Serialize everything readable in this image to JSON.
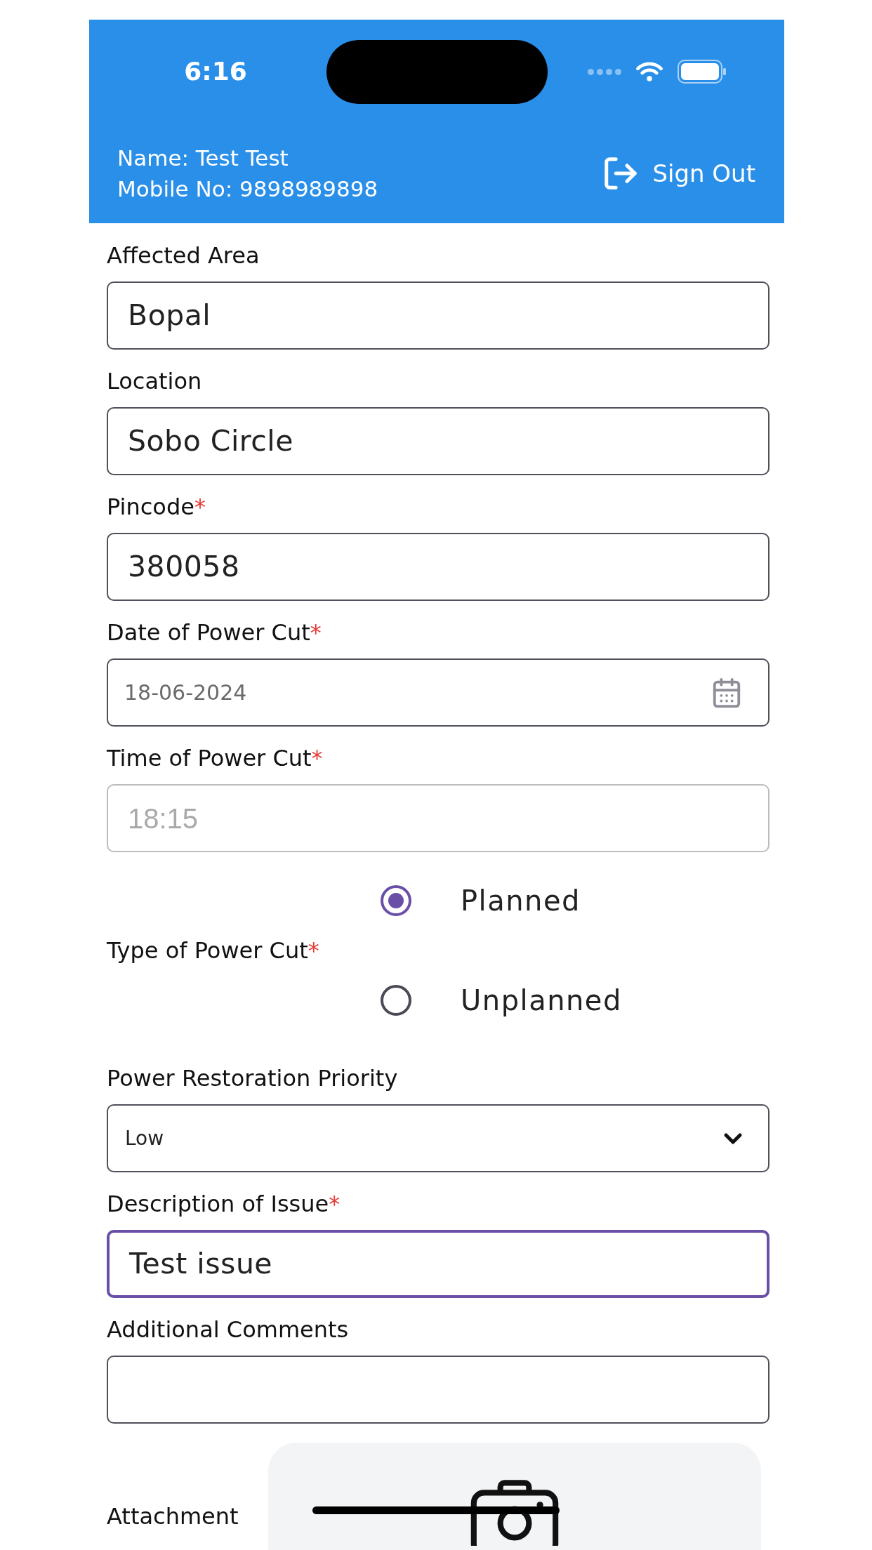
{
  "status_bar": {
    "time": "6:16"
  },
  "header": {
    "name": "Name: Test Test",
    "mobile": "Mobile No: 9898989898",
    "sign_out": "Sign Out"
  },
  "form": {
    "fields": [
      {
        "kind": "text",
        "label": "Affected Area",
        "value": "Bopal",
        "focused": false,
        "disabled": false
      },
      {
        "kind": "text",
        "label": "Location",
        "value": "Sobo Circle",
        "focused": false,
        "disabled": false
      },
      {
        "kind": "text",
        "label": "Pincode",
        "required_mark": "*",
        "value": "380058",
        "focused": false,
        "disabled": false
      },
      {
        "kind": "date",
        "label": "Date of Power Cut",
        "required_mark": "*",
        "value": "18-06-2024",
        "focused": false,
        "disabled": false
      },
      {
        "kind": "time",
        "label": "Time of Power Cut",
        "required_mark": "*",
        "value": "18:15",
        "focused": false,
        "disabled": true
      },
      {
        "kind": "radio",
        "label": "Type of Power Cut",
        "required_mark": "*",
        "options": [
          {
            "label": "Planned",
            "selected": true
          },
          {
            "label": "Unplanned",
            "selected": false
          }
        ]
      },
      {
        "kind": "select",
        "label": "Power Restoration Priority",
        "value": "Low",
        "focused": false,
        "disabled": false
      },
      {
        "kind": "text",
        "label": "Description of Issue",
        "required_mark": "*",
        "value": "Test issue",
        "focused": true,
        "disabled": false
      },
      {
        "kind": "text",
        "label": "Additional Comments",
        "focused": false,
        "disabled": false
      },
      {
        "kind": "attachment",
        "label": "Attachment"
      }
    ]
  }
}
